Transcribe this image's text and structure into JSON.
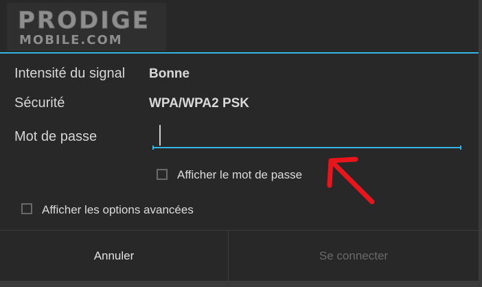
{
  "watermark": {
    "line1": "PRODIGE",
    "line2": "MOBILE.COM"
  },
  "details": {
    "signal_label": "Intensité du signal",
    "signal_value": "Bonne",
    "security_label": "Sécurité",
    "security_value": "WPA/WPA2 PSK",
    "password_label": "Mot de passe",
    "password_value": ""
  },
  "options": {
    "show_password": {
      "label": "Afficher le mot de passe",
      "checked": false
    },
    "advanced": {
      "label": "Afficher les options avancées",
      "checked": false
    }
  },
  "buttons": {
    "cancel": "Annuler",
    "connect": "Se connecter"
  },
  "colors": {
    "accent": "#33b5e5",
    "annotation_arrow": "#e8161c",
    "disabled_text": "#6a6a6a"
  }
}
